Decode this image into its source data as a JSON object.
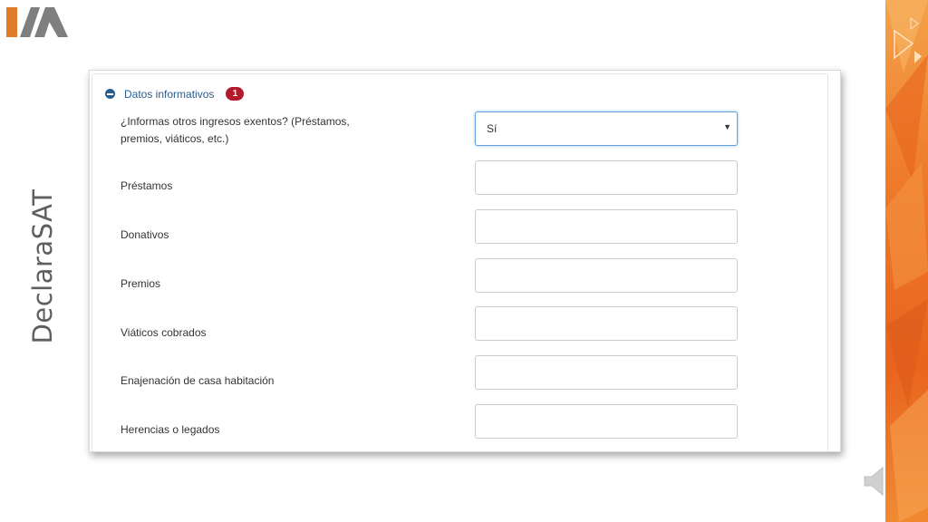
{
  "slide": {
    "side_title": "DeclaraSAT",
    "logo_icon": "ima-logo-icon",
    "speaker_icon": "speaker-icon",
    "accent_orange": "#ee7a2a",
    "logo_gray": "#7f7f7f"
  },
  "form": {
    "section_title": "Datos informativos",
    "badge_count": "1",
    "question_label": "¿Informas otros ingresos exentos? (Préstamos, premios, viáticos, etc.)",
    "select_value": "Sí",
    "select_caret": "▼",
    "fields": [
      {
        "label": "Préstamos",
        "value": ""
      },
      {
        "label": "Donativos",
        "value": ""
      },
      {
        "label": "Premios",
        "value": ""
      },
      {
        "label": "Viáticos cobrados",
        "value": ""
      },
      {
        "label": "Enajenación de casa habitación",
        "value": ""
      },
      {
        "label": "Herencias o legados",
        "value": ""
      }
    ],
    "link_color": "#2a5d8f",
    "badge_color": "#b21b2c"
  }
}
